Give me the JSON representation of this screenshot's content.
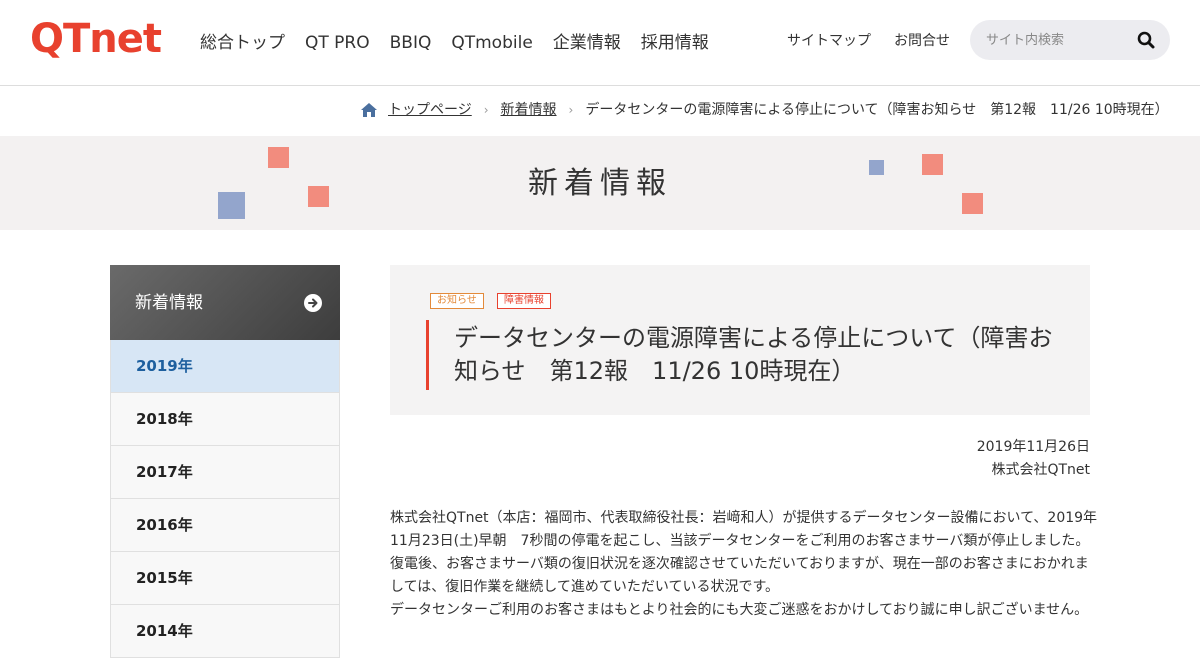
{
  "header": {
    "logo": "QTnet",
    "nav": [
      "総合トップ",
      "QT PRO",
      "BBIQ",
      "QTmobile",
      "企業情報",
      "採用情報"
    ],
    "util": [
      "サイトマップ",
      "お問合せ"
    ],
    "search_placeholder": "サイト内検索"
  },
  "breadcrumb": {
    "home": "トップページ",
    "section": "新着情報",
    "current": "データセンターの電源障害による停止について（障害お知らせ　第12報　11/26 10時現在）"
  },
  "banner": {
    "title": "新着情報"
  },
  "sidebar": {
    "heading": "新着情報",
    "years": [
      "2019年",
      "2018年",
      "2017年",
      "2016年",
      "2015年",
      "2014年"
    ],
    "active_year": "2019年"
  },
  "article": {
    "tags": [
      "お知らせ",
      "障害情報"
    ],
    "title": "データセンターの電源障害による停止について（障害お知らせ　第12報　11/26 10時現在）",
    "date": "2019年11月26日",
    "company": "株式会社QTnet",
    "paragraphs": [
      "株式会社QTnet（本店：福岡市、代表取締役社長：岩﨑和人）が提供するデータセンター設備において、2019年",
      "11月23日(土)早朝　7秒間の停電を起こし、当該データセンターをご利用のお客さまサーバ類が停止しました。",
      "復電後、お客さまサーバ類の復旧状況を逐次確認させていただいておりますが、現在一部のお客さまにおかれま",
      "しては、復旧作業を継続して進めていただいている状況です。",
      "データセンターご利用のお客さまはもとより社会的にも大変ご迷惑をおかけしており誠に申し訳ございません。"
    ]
  },
  "colors": {
    "brand": "#e8412e",
    "accent_blue": "#1d5f9e",
    "square_blue": "#93a5cc",
    "square_red": "#f28c7e"
  }
}
